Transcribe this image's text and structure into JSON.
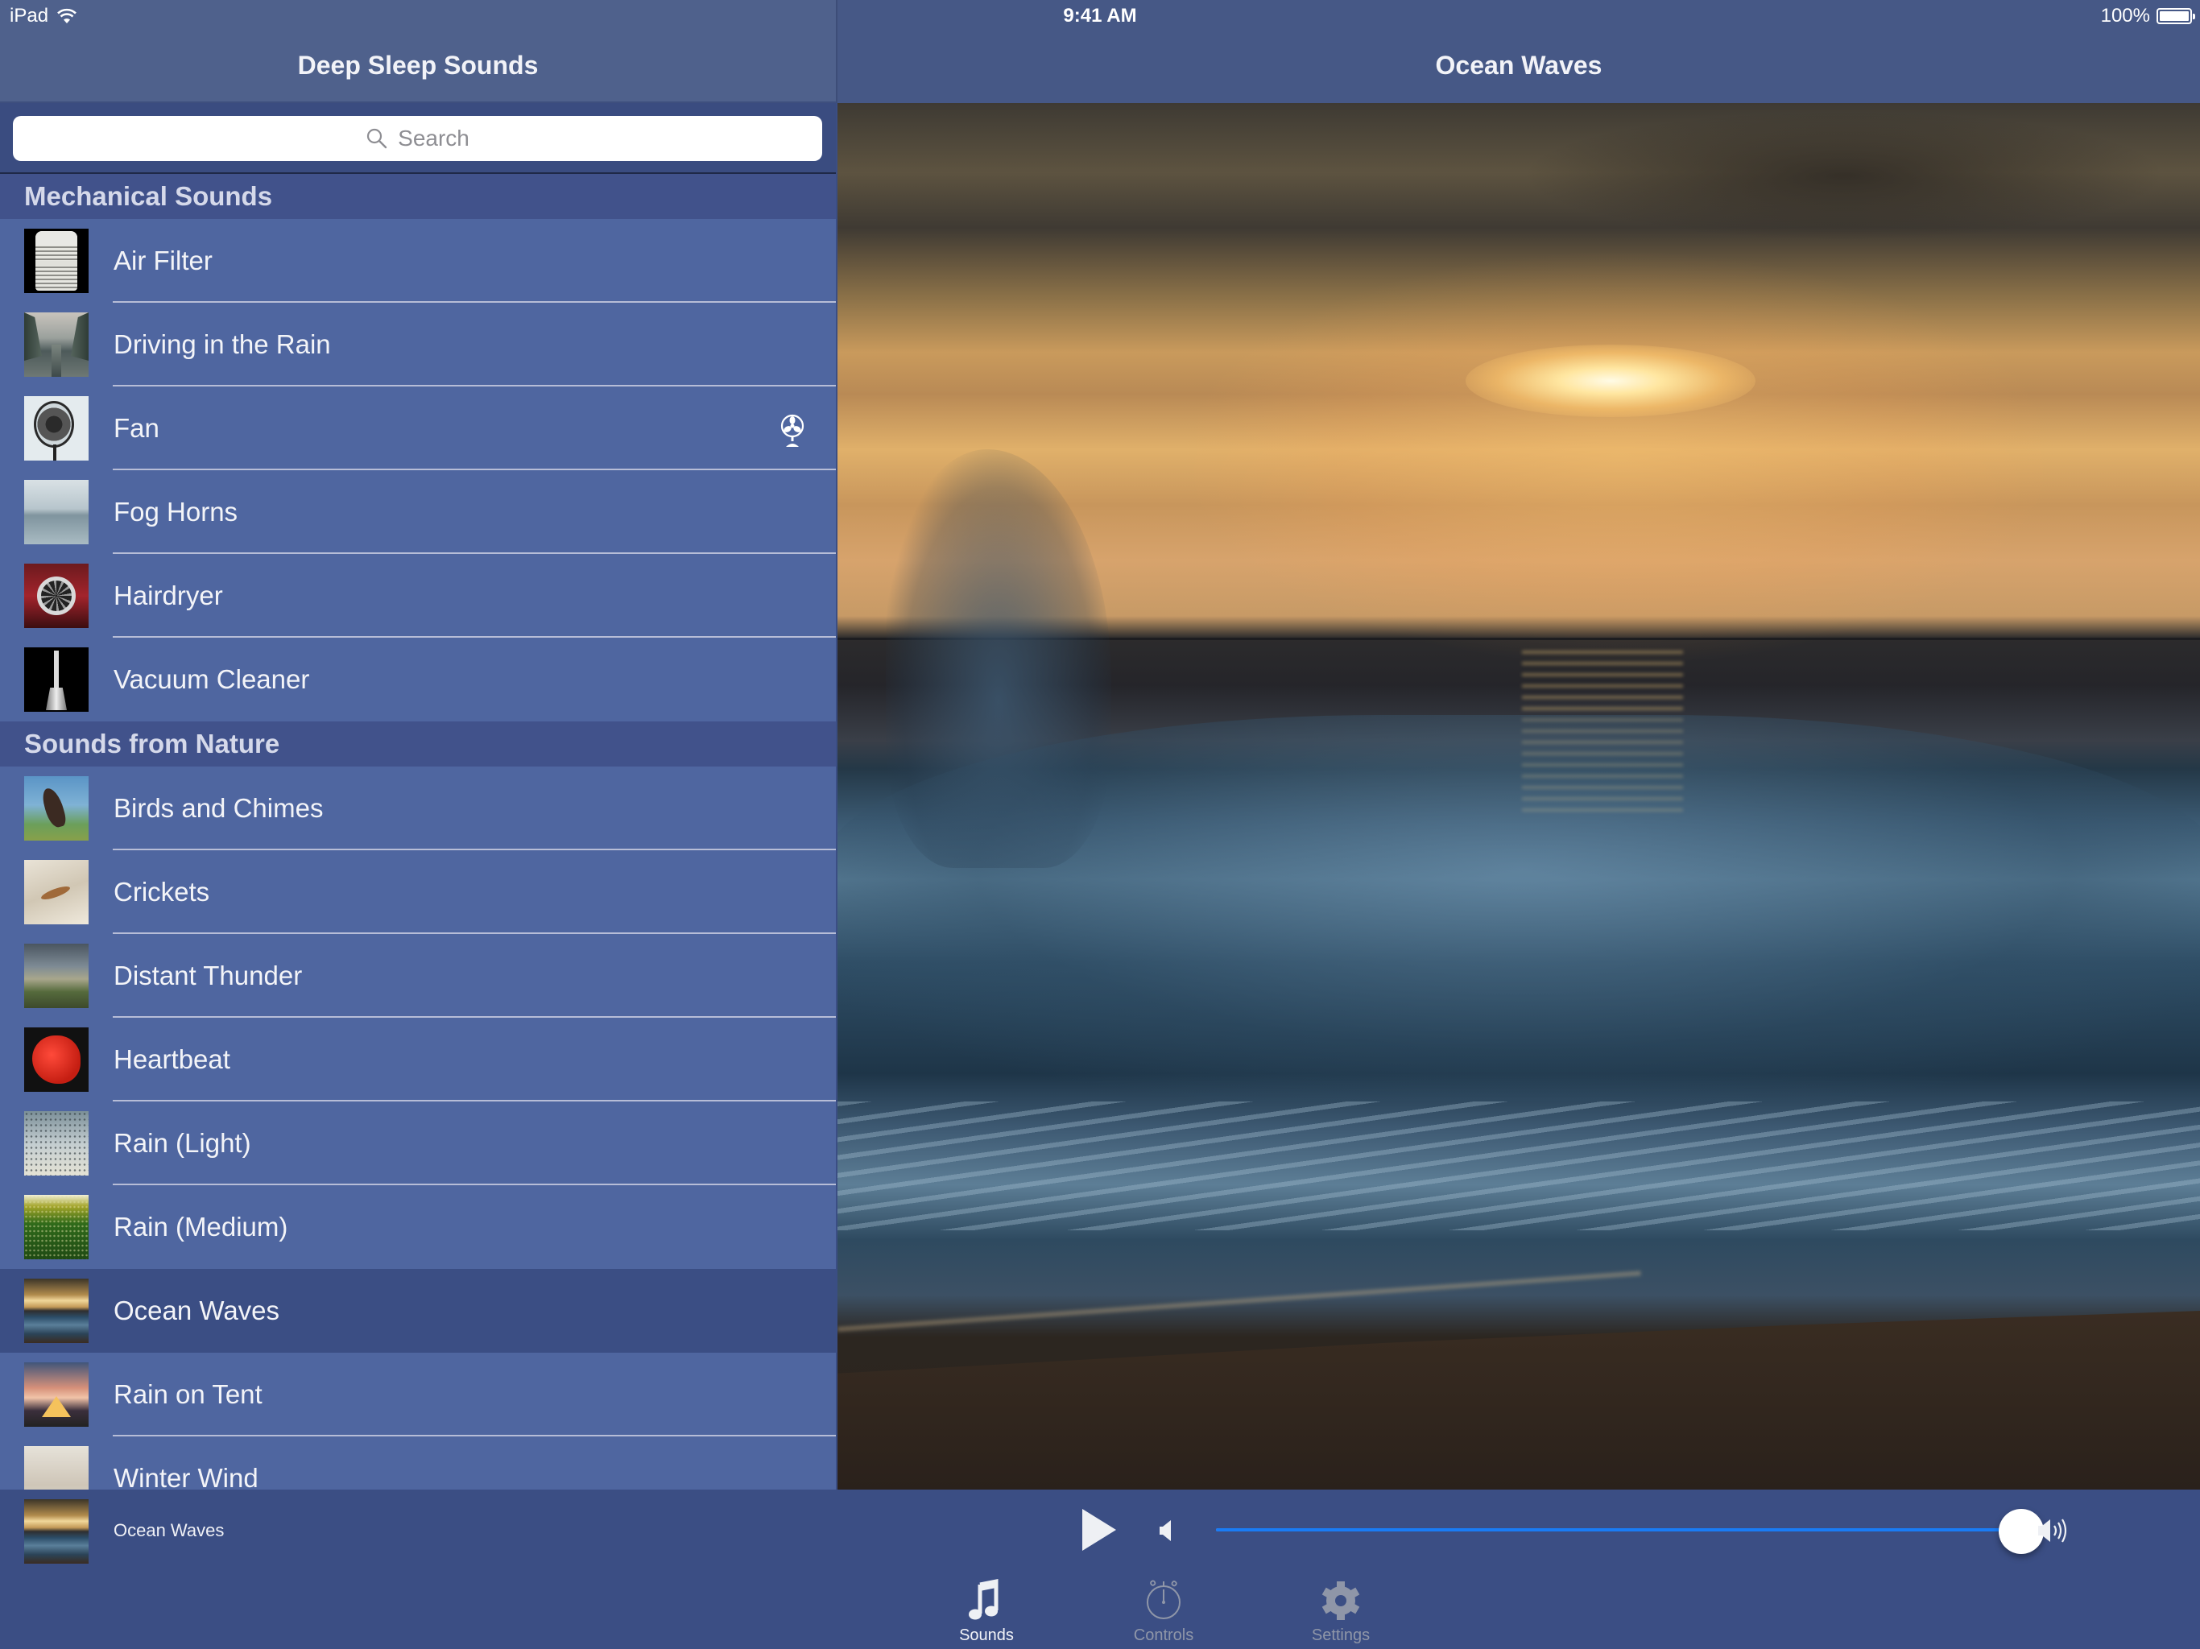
{
  "status_bar": {
    "carrier": "iPad",
    "time": "9:41 AM",
    "battery_percent": "100%",
    "battery_level": 1.0
  },
  "sidebar": {
    "title": "Deep Sleep Sounds",
    "search": {
      "placeholder": "Search",
      "value": ""
    },
    "sections": [
      {
        "header": "Mechanical Sounds",
        "items": [
          {
            "label": "Air Filter",
            "thumb": "air-filter"
          },
          {
            "label": "Driving in the Rain",
            "thumb": "driving-rain"
          },
          {
            "label": "Fan",
            "thumb": "fan",
            "accessory_icon": "fan-icon"
          },
          {
            "label": "Fog Horns",
            "thumb": "fog-horns"
          },
          {
            "label": "Hairdryer",
            "thumb": "hairdryer"
          },
          {
            "label": "Vacuum Cleaner",
            "thumb": "vacuum-cleaner"
          }
        ]
      },
      {
        "header": "Sounds from Nature",
        "items": [
          {
            "label": "Birds and Chimes",
            "thumb": "birds"
          },
          {
            "label": "Crickets",
            "thumb": "crickets"
          },
          {
            "label": "Distant Thunder",
            "thumb": "thunder"
          },
          {
            "label": "Heartbeat",
            "thumb": "heartbeat"
          },
          {
            "label": "Rain (Light)",
            "thumb": "rain-light"
          },
          {
            "label": "Rain (Medium)",
            "thumb": "rain-medium"
          },
          {
            "label": "Ocean Waves",
            "thumb": "ocean-waves",
            "selected": true
          },
          {
            "label": "Rain on Tent",
            "thumb": "rain-tent"
          },
          {
            "label": "Winter Wind",
            "thumb": "winter-wind"
          }
        ]
      }
    ]
  },
  "detail": {
    "title": "Ocean Waves",
    "image": "ocean-waves-sunset-photo"
  },
  "player": {
    "now_playing": "Ocean Waves",
    "state": "paused",
    "play_icon": "play-icon",
    "volume_min_icon": "volume-low-icon",
    "volume_max_icon": "volume-high-icon",
    "volume": 1.0
  },
  "tabs": [
    {
      "label": "Sounds",
      "icon": "music-note-icon",
      "active": true
    },
    {
      "label": "Controls",
      "icon": "stopwatch-icon",
      "active": false
    },
    {
      "label": "Settings",
      "icon": "gear-icon",
      "active": false
    }
  ],
  "colors": {
    "nav_bar": "#4f618c",
    "list_row": "#4f66a0",
    "selected_row": "#3b4e84",
    "section_header": "#41528b",
    "player_bg": "#3b4e84",
    "slider_fill": "#1a7cf5"
  }
}
